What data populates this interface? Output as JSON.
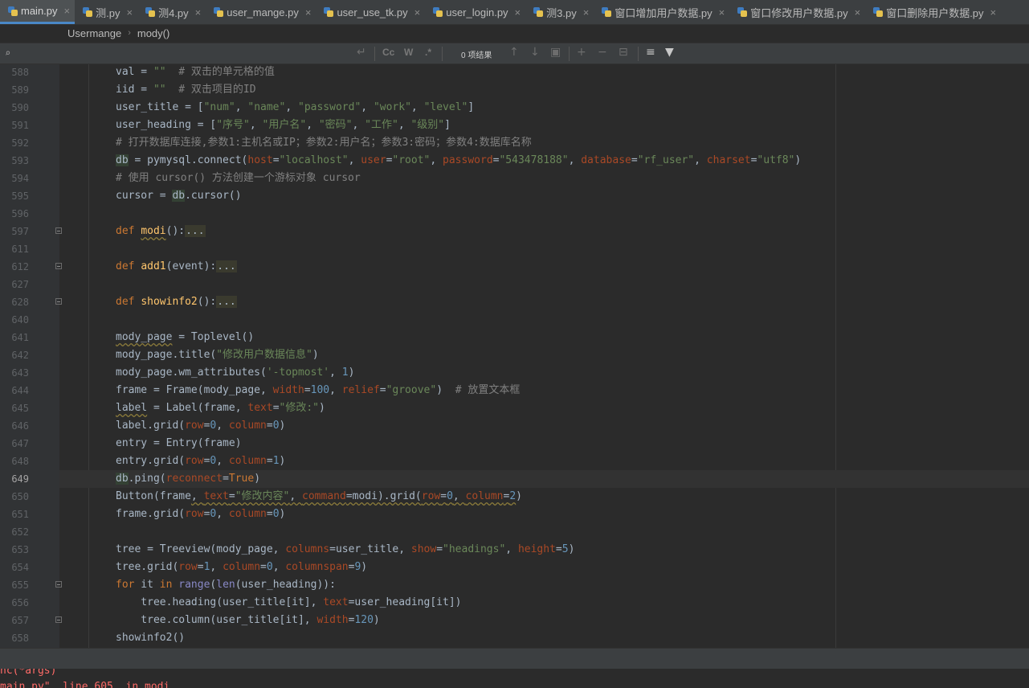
{
  "tabs": [
    {
      "label": "main.py",
      "active": true
    },
    {
      "label": "测.py",
      "active": false
    },
    {
      "label": "测4.py",
      "active": false
    },
    {
      "label": "user_mange.py",
      "active": false
    },
    {
      "label": "user_use_tk.py",
      "active": false
    },
    {
      "label": "user_login.py",
      "active": false
    },
    {
      "label": "测3.py",
      "active": false
    },
    {
      "label": "窗口增加用户数据.py",
      "active": false
    },
    {
      "label": "窗口修改用户数据.py",
      "active": false
    },
    {
      "label": "窗口删除用户数据.py",
      "active": false
    }
  ],
  "breadcrumb": {
    "class_name": "Usermange",
    "method_name": "mody()"
  },
  "search": {
    "value": "",
    "match_case_label": "Cc",
    "words_label": "W",
    "regex_label": ".*",
    "results_label": "0 项结果"
  },
  "lines": [
    {
      "num": "588",
      "html": "val = <span class=\"str\">\"\"</span>  <span class=\"cm\"># 双击的单元格的值</span>"
    },
    {
      "num": "589",
      "html": "iid = <span class=\"str\">\"\"</span>  <span class=\"cm\"># 双击项目的ID</span>"
    },
    {
      "num": "590",
      "html": "user_title = [<span class=\"str\">\"num\"</span>, <span class=\"str\">\"name\"</span>, <span class=\"str\">\"password\"</span>, <span class=\"str\">\"work\"</span>, <span class=\"str\">\"level\"</span>]"
    },
    {
      "num": "591",
      "html": "user_heading = [<span class=\"str\">\"序号\"</span>, <span class=\"str\">\"用户名\"</span>, <span class=\"str\">\"密码\"</span>, <span class=\"str\">\"工作\"</span>, <span class=\"str\">\"级别\"</span>]"
    },
    {
      "num": "592",
      "html": "<span class=\"cm\"># 打开数据库连接,参数1:主机名或IP；参数2:用户名；参数3:密码；参数4:数据库名称</span>"
    },
    {
      "num": "593",
      "html": "<span class=\"hl-db\">db</span> = pymysql.connect(<span class=\"par\">host</span>=<span class=\"str\">\"localhost\"</span>, <span class=\"par\">user</span>=<span class=\"str\">\"root\"</span>, <span class=\"par\">password</span>=<span class=\"str\">\"543478188\"</span>, <span class=\"par\">database</span>=<span class=\"str\">\"rf_user\"</span>, <span class=\"par\">charset</span>=<span class=\"str\">\"utf8\"</span>)"
    },
    {
      "num": "594",
      "html": "<span class=\"cm\"># 使用 cursor() 方法创建一个游标对象 cursor</span>"
    },
    {
      "num": "595",
      "html": "cursor = <span class=\"hl-db\">db</span>.cursor()"
    },
    {
      "num": "596",
      "html": ""
    },
    {
      "num": "597",
      "html": "<span class=\"kw\">def</span> <span class=\"fn warn\">modi</span>():<span class=\"fold-text\">...</span>",
      "fold": true
    },
    {
      "num": "611",
      "html": ""
    },
    {
      "num": "612",
      "html": "<span class=\"kw\">def</span> <span class=\"fn\">add1</span>(event):<span class=\"fold-text\">...</span>",
      "fold": true
    },
    {
      "num": "627",
      "html": ""
    },
    {
      "num": "628",
      "html": "<span class=\"kw\">def</span> <span class=\"fn\">showinfo2</span>():<span class=\"fold-text\">...</span>",
      "fold": true
    },
    {
      "num": "640",
      "html": ""
    },
    {
      "num": "641",
      "html": "<span class=\"warn\">mody_page</span> = Toplevel()"
    },
    {
      "num": "642",
      "html": "mody_page.title(<span class=\"str\">\"修改用户数据信息\"</span>)"
    },
    {
      "num": "643",
      "html": "mody_page.wm_attributes(<span class=\"str\">'-topmost'</span>, <span class=\"num\">1</span>)"
    },
    {
      "num": "644",
      "html": "frame = Frame(mody_page, <span class=\"par\">width</span>=<span class=\"num\">100</span>, <span class=\"par\">relief</span>=<span class=\"str\">\"groove\"</span>)  <span class=\"cm\"># 放置文本框</span>"
    },
    {
      "num": "645",
      "html": "<span class=\"warn\">label</span> = Label(frame, <span class=\"par\">text</span>=<span class=\"str\">\"修改:\"</span>)"
    },
    {
      "num": "646",
      "html": "label.grid(<span class=\"par\">row</span>=<span class=\"num\">0</span>, <span class=\"par\">column</span>=<span class=\"num\">0</span>)"
    },
    {
      "num": "647",
      "html": "entry = Entry(frame)"
    },
    {
      "num": "648",
      "html": "entry.grid(<span class=\"par\">row</span>=<span class=\"num\">0</span>, <span class=\"par\">column</span>=<span class=\"num\">1</span>)"
    },
    {
      "num": "649",
      "html": "<span class=\"hl-db\">db</span>.ping(<span class=\"par\">reconnect</span>=<span class=\"kw\">True</span>)",
      "current": true
    },
    {
      "num": "650",
      "html": "Button(frame<span class=\"warn\">, <span class=\"par\">text</span>=<span class=\"str\">\"修改内容\"</span>, <span class=\"par\">command</span>=modi).grid(<span class=\"par\">row</span>=<span class=\"num\">0</span>, <span class=\"par\">column</span>=<span class=\"num\">2</span></span>)"
    },
    {
      "num": "651",
      "html": "frame.grid(<span class=\"par\">row</span>=<span class=\"num\">0</span>, <span class=\"par\">column</span>=<span class=\"num\">0</span>)"
    },
    {
      "num": "652",
      "html": ""
    },
    {
      "num": "653",
      "html": "tree = Treeview(mody_page, <span class=\"par\">columns</span>=user_title, <span class=\"par\">show</span>=<span class=\"str\">\"headings\"</span>, <span class=\"par\">height</span>=<span class=\"num\">5</span>)"
    },
    {
      "num": "654",
      "html": "tree.grid(<span class=\"par\">row</span>=<span class=\"num\">1</span>, <span class=\"par\">column</span>=<span class=\"num\">0</span>, <span class=\"par\">columnspan</span>=<span class=\"num\">9</span>)"
    },
    {
      "num": "655",
      "html": "<span class=\"kw\">for</span> it <span class=\"kw\">in</span> <span class=\"bi\">range</span>(<span class=\"bi\">len</span>(user_heading)):",
      "fold": true
    },
    {
      "num": "656",
      "html": "    tree.heading(user_title[it], <span class=\"par\">text</span>=user_heading[it])"
    },
    {
      "num": "657",
      "html": "    tree.column(user_title[it], <span class=\"par\">width</span>=<span class=\"num\">120</span>)",
      "fold": true
    },
    {
      "num": "658",
      "html": "showinfo2()"
    }
  ],
  "console": [
    "nc(*args)",
    "main.py\", line 605, in modi"
  ]
}
